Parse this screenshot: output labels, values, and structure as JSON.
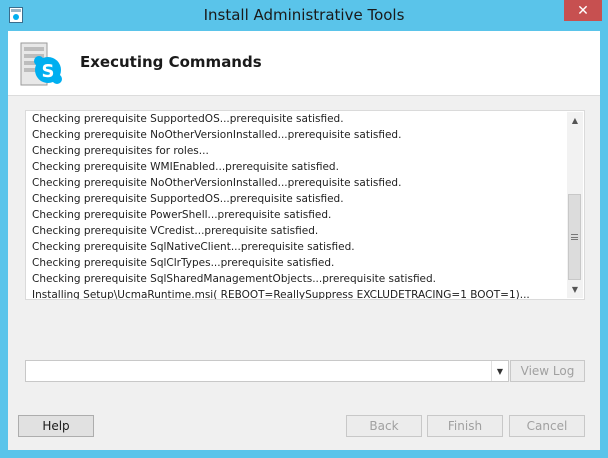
{
  "window": {
    "title": "Install Administrative Tools",
    "close_glyph": "✕"
  },
  "header": {
    "title": "Executing Commands",
    "icon": "skype-server-icon"
  },
  "log": {
    "lines": [
      "Checking prerequisite SupportedOS...prerequisite satisfied.",
      "Checking prerequisite NoOtherVersionInstalled...prerequisite satisfied.",
      "Checking prerequisites for roles...",
      "Checking prerequisite WMIEnabled...prerequisite satisfied.",
      "Checking prerequisite NoOtherVersionInstalled...prerequisite satisfied.",
      "Checking prerequisite SupportedOS...prerequisite satisfied.",
      "Checking prerequisite PowerShell...prerequisite satisfied.",
      "Checking prerequisite VCredist...prerequisite satisfied.",
      "Checking prerequisite SqlNativeClient...prerequisite satisfied.",
      "Checking prerequisite SqlClrTypes...prerequisite satisfied.",
      "Checking prerequisite SqlSharedManagementObjects...prerequisite satisfied.",
      "Installing Setup\\UcmaRuntime.msi( REBOOT=ReallySuppress  EXCLUDETRACING=1 BOOT=1)..."
    ]
  },
  "combo": {
    "value": ""
  },
  "buttons": {
    "view_log": "View Log",
    "help": "Help",
    "back": "Back",
    "finish": "Finish",
    "cancel": "Cancel"
  },
  "colors": {
    "titlebar": "#5ac4ea",
    "close": "#c75050",
    "skype_blue": "#00aff0"
  }
}
